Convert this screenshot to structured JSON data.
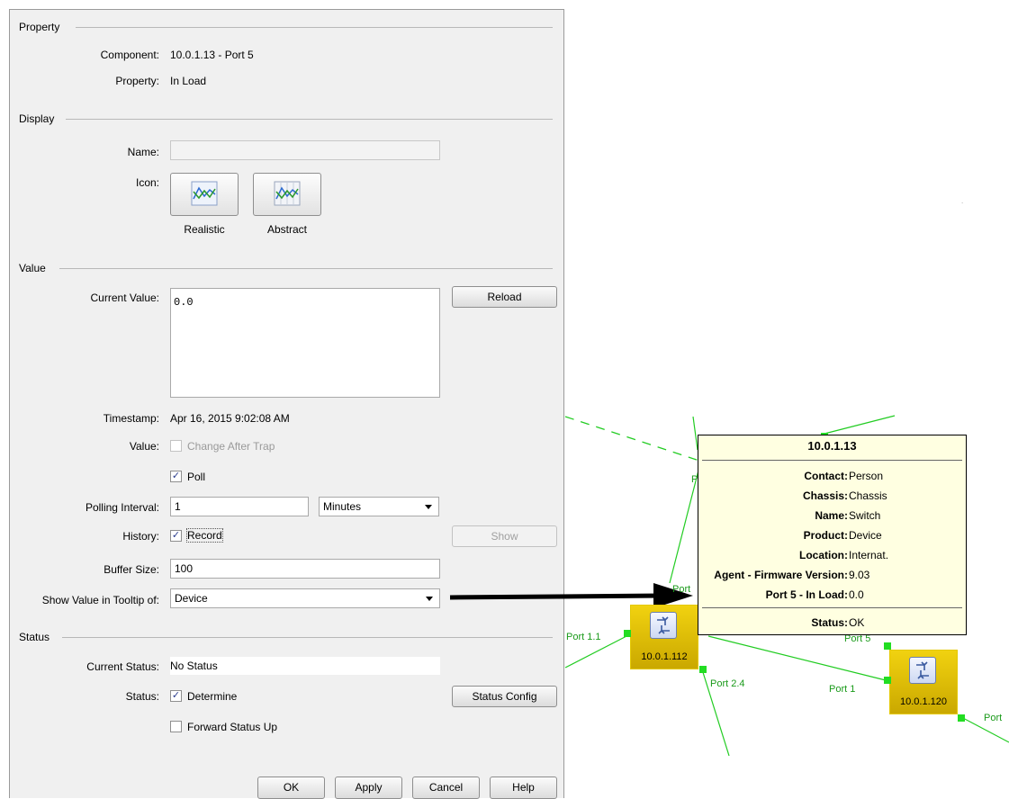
{
  "dialog": {
    "property_section": {
      "title": "Property",
      "component_label": "Component:",
      "component_value": "10.0.1.13 - Port 5",
      "property_label": "Property:",
      "property_value": "In Load"
    },
    "display_section": {
      "title": "Display",
      "name_label": "Name:",
      "name_value": "",
      "icon_label": "Icon:",
      "icon_realistic": "Realistic",
      "icon_abstract": "Abstract"
    },
    "value_section": {
      "title": "Value",
      "current_value_label": "Current Value:",
      "current_value": "0.0",
      "reload_button": "Reload",
      "timestamp_label": "Timestamp:",
      "timestamp_value": "Apr 16, 2015 9:02:08 AM",
      "value_label": "Value:",
      "change_after_trap": "Change After Trap",
      "change_after_trap_checked": false,
      "poll": "Poll",
      "poll_checked": true,
      "polling_interval_label": "Polling Interval:",
      "polling_interval_value": "1",
      "polling_unit": "Minutes",
      "history_label": "History:",
      "record": "Record",
      "record_checked": true,
      "show_button": "Show",
      "buffer_size_label": "Buffer Size:",
      "buffer_size_value": "100",
      "tooltip_label": "Show Value in Tooltip of:",
      "tooltip_value": "Device"
    },
    "status_section": {
      "title": "Status",
      "current_status_label": "Current Status:",
      "current_status_value": "No Status",
      "status_label": "Status:",
      "determine": "Determine",
      "determine_checked": true,
      "status_config_button": "Status Config",
      "forward_status_up": "Forward Status Up",
      "forward_status_up_checked": false
    },
    "buttons": {
      "ok": "OK",
      "apply": "Apply",
      "cancel": "Cancel",
      "help": "Help"
    }
  },
  "tooltip": {
    "title": "10.0.1.13",
    "rows": [
      {
        "key": "Contact:",
        "value": "Person"
      },
      {
        "key": "Chassis:",
        "value": "Chassis"
      },
      {
        "key": "Name:",
        "value": "Switch"
      },
      {
        "key": "Product:",
        "value": "Device"
      },
      {
        "key": "Location:",
        "value": "Internat."
      },
      {
        "key": "Agent - Firmware Version:",
        "value": "9.03"
      },
      {
        "key": "Port 5 - In Load:",
        "value": "0.0"
      }
    ],
    "status_key": "Status:",
    "status_value": "OK"
  },
  "network": {
    "nodes": [
      {
        "label": "10.0.1.112"
      },
      {
        "label": "10.0.1.120"
      }
    ],
    "port_labels": {
      "port_1_1": "Port 1.1",
      "port_2_4": "Port 2.4",
      "port_1": "Port 1",
      "port_5": "Port 5",
      "port_partial_top": "Port",
      "port_partial_left": "P",
      "port_partial_right": "Port"
    },
    "colors": {
      "link": "#22cc22",
      "node": "#e6c300",
      "tooltip_bg": "#ffffe1"
    }
  }
}
